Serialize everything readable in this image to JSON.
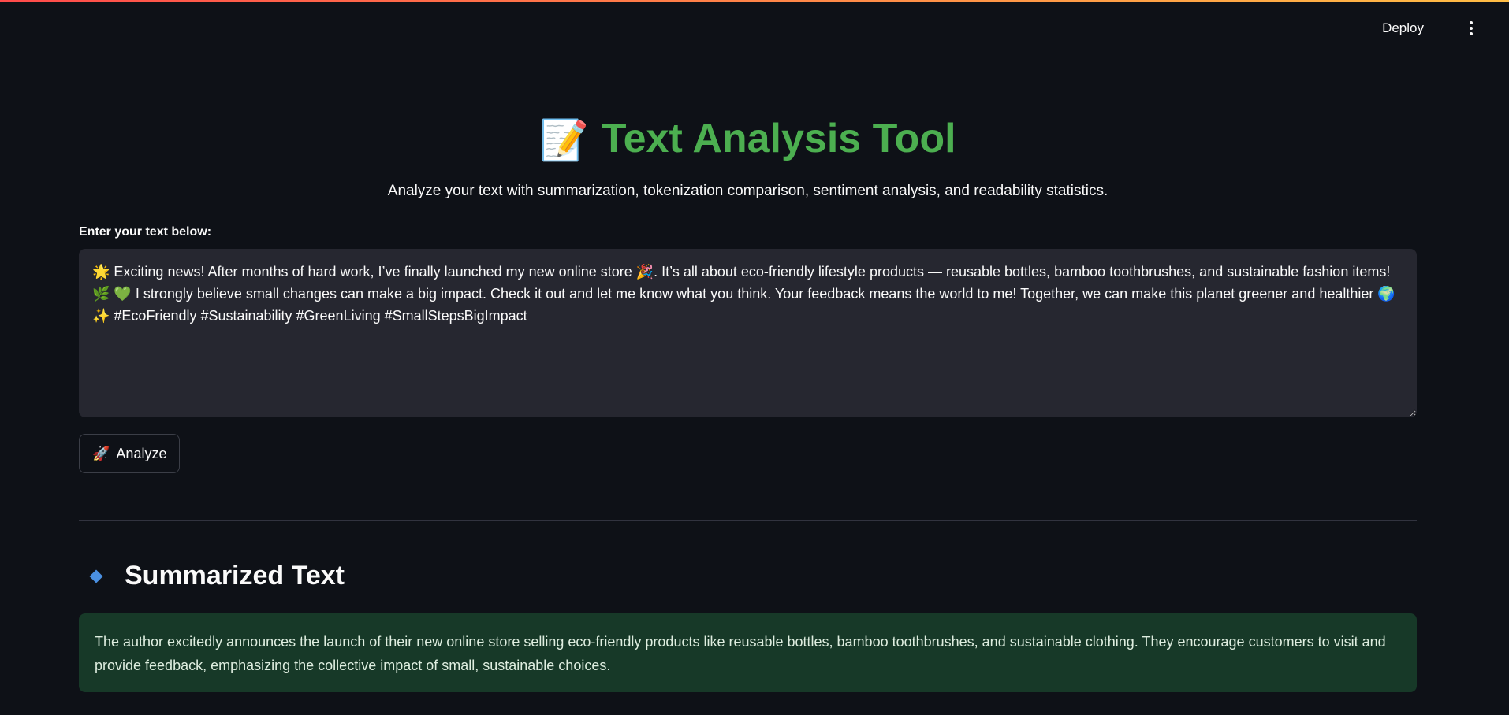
{
  "header": {
    "deploy_label": "Deploy"
  },
  "app": {
    "title_emoji": "📝",
    "title": "Text Analysis Tool",
    "subtitle": "Analyze your text with summarization, tokenization comparison, sentiment analysis, and readability statistics."
  },
  "input": {
    "label": "Enter your text below:",
    "value": "🌟 Exciting news! After months of hard work, I’ve finally launched my new online store 🎉. It’s all about eco-friendly lifestyle products — reusable bottles, bamboo toothbrushes, and sustainable fashion items! 🌿 💚 I strongly believe small changes can make a big impact. Check it out and let me know what you think. Your feedback means the world to me! Together, we can make this planet greener and healthier 🌍 ✨ #EcoFriendly #Sustainability #GreenLiving #SmallStepsBigImpact"
  },
  "analyze_button": {
    "icon": "🚀",
    "label": "Analyze"
  },
  "summary": {
    "heading": "Summarized Text",
    "text": "The author excitedly announces the launch of their new online store selling eco-friendly products like reusable bottles, bamboo toothbrushes, and sustainable clothing. They encourage customers to visit and provide feedback, emphasizing the collective impact of small, sustainable choices."
  },
  "colors": {
    "background": "#0e1117",
    "title_green": "#4caf50",
    "summary_bg": "#173928",
    "diamond_blue": "#4a90e2"
  }
}
